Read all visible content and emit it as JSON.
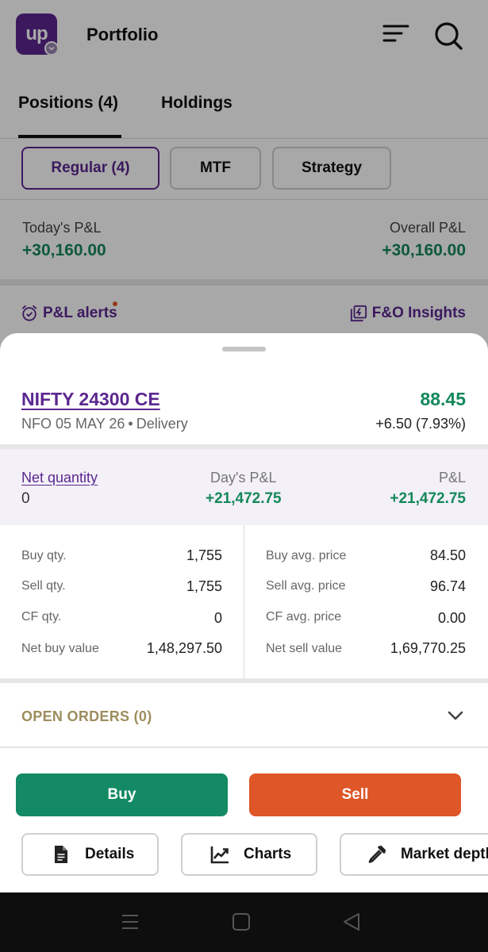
{
  "app": {
    "logo_text": "up",
    "title": "Portfolio"
  },
  "tabs": [
    {
      "label": "Positions (4)",
      "active": true
    },
    {
      "label": "Holdings",
      "active": false
    }
  ],
  "filters": [
    {
      "label": "Regular (4)",
      "active": true
    },
    {
      "label": "MTF"
    },
    {
      "label": "Strategy"
    }
  ],
  "summary": {
    "today_label": "Today's P&L",
    "today_value": "+30,160.00",
    "overall_label": "Overall P&L",
    "overall_value": "+30,160.00"
  },
  "links": {
    "alerts": "P&L alerts",
    "insights": "F&O Insights"
  },
  "sheet": {
    "instrument": "NIFTY 24300 CE",
    "exchange": "NFO",
    "expiry": "05 MAY 26",
    "product": "Delivery",
    "ltp": "88.45",
    "change": "+6.50 (7.93%)",
    "net_quantity_label": "Net quantity",
    "net_quantity_value": "0",
    "day_pnl_label": "Day's P&L",
    "day_pnl_value": "+21,472.75",
    "pnl_label": "P&L",
    "pnl_value": "+21,472.75",
    "left_rows": [
      {
        "label": "Buy qty.",
        "value": "1,755"
      },
      {
        "label": "Sell qty.",
        "value": "1,755"
      },
      {
        "label": "CF qty.",
        "value": "0"
      },
      {
        "label": "Net buy value",
        "value": "1,48,297.50"
      }
    ],
    "right_rows": [
      {
        "label": "Buy avg. price",
        "value": "84.50"
      },
      {
        "label": "Sell avg. price",
        "value": "96.74"
      },
      {
        "label": "CF avg. price",
        "value": "0.00"
      },
      {
        "label": "Net sell value",
        "value": "1,69,770.25"
      }
    ],
    "open_orders": "OPEN ORDERS (0)",
    "buy_label": "Buy",
    "sell_label": "Sell",
    "actions": {
      "details": "Details",
      "charts": "Charts",
      "depth": "Market depth"
    }
  },
  "colors": {
    "brand": "#5b2790",
    "profit": "#14885a",
    "buy": "#138a63",
    "sell": "#df5628",
    "open_orders": "#9d8d5e"
  },
  "icons": [
    "filter-icon",
    "search-icon",
    "alarm-icon",
    "insights-icon",
    "chevron-down-icon",
    "document-icon",
    "chart-icon",
    "dropper-icon",
    "menu-icon",
    "home-icon",
    "back-icon"
  ]
}
